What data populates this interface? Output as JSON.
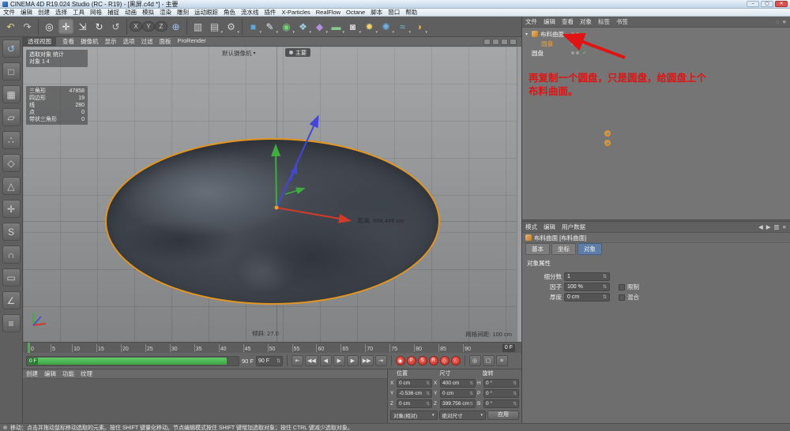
{
  "window": {
    "title": "CINEMA 4D R19.024 Studio (RC - R19) - [黑屏.c4d *] - 主要",
    "controls": [
      {
        "name": "minimize",
        "glyph": "–"
      },
      {
        "name": "maximize",
        "glyph": "▢"
      },
      {
        "name": "close",
        "glyph": "✕"
      }
    ]
  },
  "menubar": {
    "items": [
      "文件",
      "编辑",
      "创建",
      "选择",
      "工具",
      "网格",
      "捕捉",
      "动画",
      "模拟",
      "渲染",
      "雕刻",
      "运动跟踪",
      "角色",
      "流水线",
      "插件",
      "X-Particles",
      "RealFlow",
      "Octane",
      "脚本",
      "窗口",
      "帮助"
    ]
  },
  "toolbar": {
    "items": [
      {
        "name": "undo",
        "glyph": "↶",
        "color": "#e8d27c"
      },
      {
        "name": "redo",
        "glyph": "↷",
        "color": "#cfcfcf"
      },
      {
        "sep": true
      },
      {
        "name": "live-selection",
        "glyph": "◎",
        "color": "#ededed"
      },
      {
        "name": "move-tool",
        "glyph": "✛",
        "color": "#f5f5f5",
        "active": true
      },
      {
        "name": "scale-tool",
        "glyph": "⇲",
        "color": "#ededed"
      },
      {
        "name": "rotate-tool",
        "glyph": "↻",
        "color": "#ededed"
      },
      {
        "name": "last-tool",
        "glyph": "↺",
        "color": "#c8c8c8"
      },
      {
        "sep": true
      },
      {
        "name": "lock-x-axis",
        "glyph": "X",
        "pill": true
      },
      {
        "name": "lock-y-axis",
        "glyph": "Y",
        "pill": true
      },
      {
        "name": "lock-z-axis",
        "glyph": "Z",
        "pill": true
      },
      {
        "name": "coordinate-system",
        "glyph": "⊕",
        "color": "#9fc3e8"
      },
      {
        "sep": true
      },
      {
        "name": "render-view",
        "glyph": "▥",
        "color": "#d0d0d0"
      },
      {
        "name": "render-picture-viewer",
        "glyph": "▤",
        "color": "#d0d0d0",
        "menu": true
      },
      {
        "name": "render-settings",
        "glyph": "⚙",
        "color": "#d0d0d0",
        "menu": true
      },
      {
        "sep": true
      },
      {
        "name": "primitive-cube",
        "glyph": "■",
        "color": "#5aa7e0",
        "menu": true
      },
      {
        "name": "spline-pen",
        "glyph": "✎",
        "color": "#dce8f2",
        "menu": true
      },
      {
        "name": "subdivision-surface",
        "glyph": "◉",
        "color": "#7bd17b",
        "menu": true
      },
      {
        "name": "generators",
        "glyph": "❖",
        "color": "#9fcfeb",
        "menu": true
      },
      {
        "name": "deformers",
        "glyph": "◆",
        "color": "#b491e0",
        "menu": true
      },
      {
        "name": "environment",
        "glyph": "▬",
        "color": "#86c98f",
        "menu": true
      },
      {
        "name": "camera-objects",
        "glyph": "◙",
        "color": "#d8d8d8",
        "menu": true
      },
      {
        "name": "light-objects",
        "glyph": "✹",
        "color": "#f2d46b",
        "menu": true
      },
      {
        "name": "xparticles-menu",
        "glyph": "✺",
        "color": "#6db7e8",
        "menu": true
      },
      {
        "name": "realflow-menu",
        "gly_x": "",
        "glyph": "≈",
        "color": "#74c6e8",
        "menu": true
      },
      {
        "name": "octane-menu",
        "glyph": "◑",
        "color": "#e8a85a",
        "menu": true
      }
    ]
  },
  "left_palette": {
    "items": [
      {
        "name": "make-editable",
        "glyph": "↺",
        "color": "#9fc3e8"
      },
      {
        "name": "model-mode",
        "glyph": "□"
      },
      {
        "name": "texture-mode",
        "glyph": "▦"
      },
      {
        "name": "workplane-mode",
        "glyph": "▱"
      },
      {
        "name": "points-mode",
        "glyph": "∴"
      },
      {
        "name": "edges-mode",
        "glyph": "◇"
      },
      {
        "name": "polygons-mode",
        "glyph": "△"
      },
      {
        "name": "enable-axis",
        "glyph": "✛"
      },
      {
        "name": "viewport-solo",
        "glyph": "S"
      },
      {
        "name": "snap-enable",
        "glyph": "∩"
      },
      {
        "name": "workplane-lock",
        "glyph": "▭"
      },
      {
        "name": "quantize",
        "glyph": "∠"
      },
      {
        "name": "display-filter",
        "glyph": "≡"
      }
    ]
  },
  "viewport": {
    "tab": "透视视图",
    "menus": [
      "查看",
      "摄像机",
      "显示",
      "选项",
      "过滤",
      "面板",
      "ProRender"
    ],
    "camera_hud": "默认摄像机",
    "take_hud": "主要",
    "hud_info": [
      "选取对象 统计",
      "对象 1  4"
    ],
    "hud_stats": [
      [
        "三角形",
        "47858"
      ],
      [
        "四边形",
        "19"
      ],
      [
        "线",
        "280"
      ],
      [
        "点",
        "0"
      ],
      [
        "带状三角形",
        "0"
      ]
    ],
    "distance_label": "距离: 604.449 cm",
    "tilt_label": "倾斜: 27.0",
    "grid_label": "网格间距: 100 cm",
    "axis_colors": {
      "x": "#d23a2a",
      "y": "#3fae3f",
      "z": "#4446d8"
    },
    "selection_color": "#e2951f"
  },
  "timeline": {
    "ruler": {
      "ticks": [
        "0",
        "5",
        "10",
        "15",
        "20",
        "25",
        "30",
        "35",
        "40",
        "45",
        "50",
        "55",
        "60",
        "65",
        "70",
        "75",
        "80",
        "85",
        "90"
      ],
      "marker": "0 F"
    },
    "slider": {
      "chip": "0 F",
      "end_label": "90 F",
      "frame_field": "90 F"
    },
    "transport": [
      {
        "name": "goto-start",
        "glyph": "⇤"
      },
      {
        "name": "previous-key",
        "glyph": "◀◀"
      },
      {
        "name": "previous-frame",
        "glyph": "◀"
      },
      {
        "name": "play",
        "glyph": "▶"
      },
      {
        "name": "next-frame",
        "glyph": "▶"
      },
      {
        "name": "next-key",
        "glyph": "▶▶"
      },
      {
        "name": "goto-end",
        "glyph": "⇥"
      }
    ],
    "record": [
      {
        "name": "record-keyframe",
        "glyph": "◉"
      },
      {
        "name": "keying-position",
        "glyph": "P"
      },
      {
        "name": "keying-scale",
        "glyph": "S"
      },
      {
        "name": "keying-rotation",
        "glyph": "R"
      },
      {
        "name": "keying-parameter",
        "glyph": "◇"
      },
      {
        "name": "keying-pla",
        "glyph": "∴"
      }
    ],
    "extras": [
      {
        "name": "auto-keying",
        "glyph": "◎"
      },
      {
        "name": "keyframe-selection",
        "glyph": "▢"
      },
      {
        "name": "playback-settings",
        "glyph": "≡"
      }
    ]
  },
  "materials": {
    "menus": [
      "创建",
      "编辑",
      "功能",
      "纹理"
    ]
  },
  "coordinates": {
    "headers": [
      "位置",
      "尺寸",
      "旋转"
    ],
    "axis_labels": [
      "X",
      "Y",
      "Z"
    ],
    "rotation_labels": [
      "H",
      "P",
      "B"
    ],
    "position": {
      "x": "0 cm",
      "y": "-0.536 cm",
      "z": "0 cm"
    },
    "size": {
      "x": "400 cm",
      "y": "0 cm",
      "z": "399.756 cm"
    },
    "rotation": {
      "h": "0 °",
      "p": "0 °",
      "b": "0 °"
    },
    "mode_dropdown": "对象(相对)",
    "size_dropdown": "绝对尺寸",
    "apply_button": "应用"
  },
  "object_manager": {
    "menus": [
      "文件",
      "编辑",
      "查看",
      "对象",
      "标签",
      "书签"
    ],
    "right_icons": [
      {
        "name": "om-search",
        "glyph": "◌"
      },
      {
        "name": "om-filter",
        "glyph": "≡"
      }
    ],
    "objects": [
      {
        "name": "布料曲面",
        "icon": "cloth",
        "level": 0,
        "expand": "▾",
        "selected": false
      },
      {
        "name": "圆盘",
        "icon": "disc",
        "level": 1,
        "selected": true
      },
      {
        "name": "圆盘",
        "icon": "disc",
        "level": 0,
        "selected": false
      }
    ]
  },
  "annotation": {
    "lines": [
      "再复制一个圆盘，只是圆盘，给圆盘上个",
      "布料曲面。"
    ],
    "color": "#e01414"
  },
  "attributes": {
    "menus": [
      "模式",
      "编辑",
      "用户数据"
    ],
    "right_icons": [
      {
        "name": "attr-back",
        "glyph": "◀"
      },
      {
        "name": "attr-forward",
        "glyph": "▶"
      },
      {
        "name": "attr-panel",
        "glyph": "▥"
      },
      {
        "name": "attr-menu",
        "glyph": "≡"
      }
    ],
    "title": "布料曲面 [布料曲面]",
    "tabs": [
      {
        "label": "基本",
        "active": false
      },
      {
        "label": "坐标",
        "active": false
      },
      {
        "label": "对象",
        "active": true
      }
    ],
    "section": "对象属性",
    "rows": [
      {
        "label": "细分数",
        "value": "1"
      },
      {
        "label": "因子",
        "value": "100 %",
        "check": "限制"
      },
      {
        "label": "厚度",
        "value": "0 cm",
        "check": "混合"
      }
    ]
  },
  "statusbar": {
    "text": "移动：点击并拖动鼠标移动选取的元素。按住 SHIFT 键量化移动。节点编辑模式按住 SHIFT 键增加选取对象；按住 CTRL 键减少选取对象。"
  }
}
